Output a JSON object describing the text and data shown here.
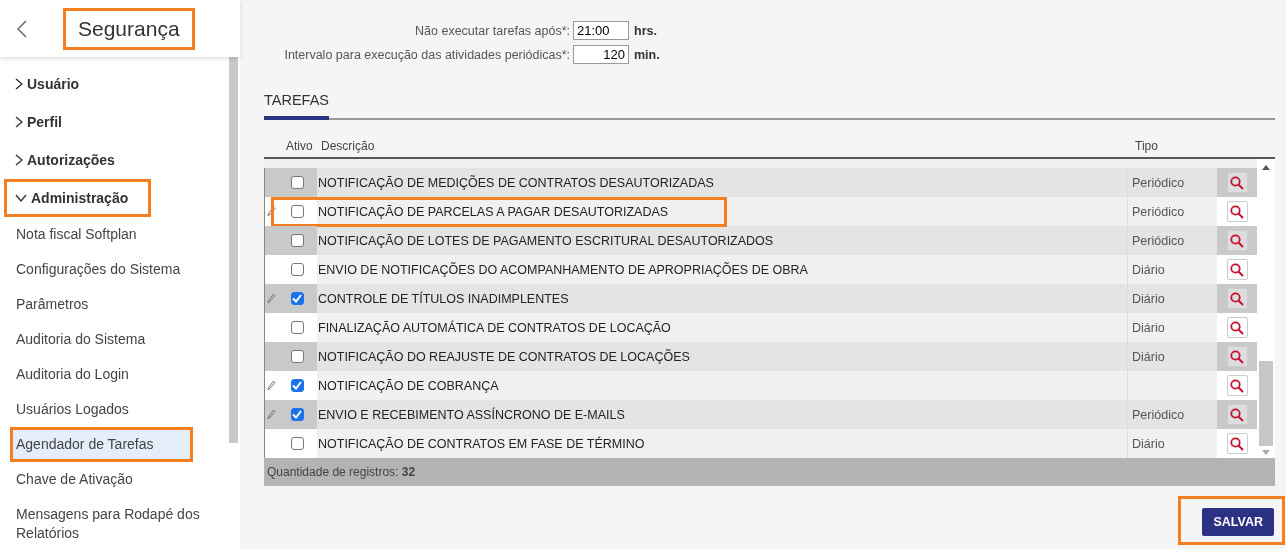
{
  "sidebar": {
    "title": "Segurança",
    "title_highlighted": true,
    "items": [
      {
        "label": "Usuário",
        "kind": "group",
        "expanded": false,
        "highlighted": false
      },
      {
        "label": "Perfil",
        "kind": "group",
        "expanded": false,
        "highlighted": false
      },
      {
        "label": "Autorizações",
        "kind": "group",
        "expanded": false,
        "highlighted": false
      },
      {
        "label": "Administração",
        "kind": "group",
        "expanded": true,
        "highlighted": true
      },
      {
        "label": "Nota fiscal Softplan",
        "kind": "link",
        "highlighted": false,
        "selected": false
      },
      {
        "label": "Configurações do Sistema",
        "kind": "link",
        "highlighted": false,
        "selected": false
      },
      {
        "label": "Parâmetros",
        "kind": "link",
        "highlighted": false,
        "selected": false
      },
      {
        "label": "Auditoria do Sistema",
        "kind": "link",
        "highlighted": false,
        "selected": false
      },
      {
        "label": "Auditoria do Login",
        "kind": "link",
        "highlighted": false,
        "selected": false
      },
      {
        "label": "Usuários Logados",
        "kind": "link",
        "highlighted": false,
        "selected": false
      },
      {
        "label": "Agendador de Tarefas",
        "kind": "link",
        "highlighted": true,
        "selected": true
      },
      {
        "label": "Chave de Ativação",
        "kind": "link",
        "highlighted": false,
        "selected": false
      },
      {
        "label": "Mensagens para Rodapé dos Relatórios",
        "kind": "link",
        "highlighted": false,
        "selected": false
      }
    ]
  },
  "settings": [
    {
      "label": "Não executar tarefas após*:",
      "value": "21:00",
      "unit": "hrs."
    },
    {
      "label": "Intervalo para execução das atividades periódicas*:",
      "value": "120",
      "unit": "min."
    }
  ],
  "tabs": [
    {
      "label": "TAREFAS",
      "selected": true
    }
  ],
  "table": {
    "columns": [
      "Ativo",
      "Descrição",
      "Tipo"
    ],
    "rows": [
      {
        "description": "NOTIFICAÇÃO DE MEDIÇÕES DE CONTRATOS DESAUTORIZADAS",
        "type": "Periódico",
        "checked": false,
        "edited": false,
        "highlighted": false
      },
      {
        "description": "NOTIFICAÇÃO DE PARCELAS A PAGAR DESAUTORIZADAS",
        "type": "Periódico",
        "checked": false,
        "edited": true,
        "highlighted": true
      },
      {
        "description": "NOTIFICAÇÃO DE LOTES DE PAGAMENTO ESCRITURAL DESAUTORIZADOS",
        "type": "Periódico",
        "checked": false,
        "edited": false,
        "highlighted": false
      },
      {
        "description": "ENVIO DE NOTIFICAÇÕES DO ACOMPANHAMENTO DE APROPRIAÇÕES DE OBRA",
        "type": "Diário",
        "checked": false,
        "edited": false,
        "highlighted": false
      },
      {
        "description": "CONTROLE DE TÍTULOS INADIMPLENTES",
        "type": "Diário",
        "checked": true,
        "edited": true,
        "highlighted": false
      },
      {
        "description": "FINALIZAÇÃO AUTOMÁTICA DE CONTRATOS DE LOCAÇÃO",
        "type": "Diário",
        "checked": false,
        "edited": false,
        "highlighted": false
      },
      {
        "description": "NOTIFICAÇÃO DO REAJUSTE DE CONTRATOS DE LOCAÇÕES",
        "type": "Diário",
        "checked": false,
        "edited": false,
        "highlighted": false
      },
      {
        "description": "NOTIFICAÇÃO DE COBRANÇA",
        "checked": true,
        "edited": true,
        "highlighted": false
      },
      {
        "description": "ENVIO E RECEBIMENTO ASSÍNCRONO DE E-MAILS",
        "type": "Periódico",
        "checked": true,
        "edited": true,
        "highlighted": false
      },
      {
        "description": "NOTIFICAÇÃO DE CONTRATOS EM FASE DE TÉRMINO",
        "type": "Diário",
        "checked": false,
        "edited": false,
        "highlighted": false
      }
    ],
    "footer": "Quantidade de registros: **32**"
  },
  "save_button": {
    "label": "SALVAR",
    "highlighted": true
  }
}
